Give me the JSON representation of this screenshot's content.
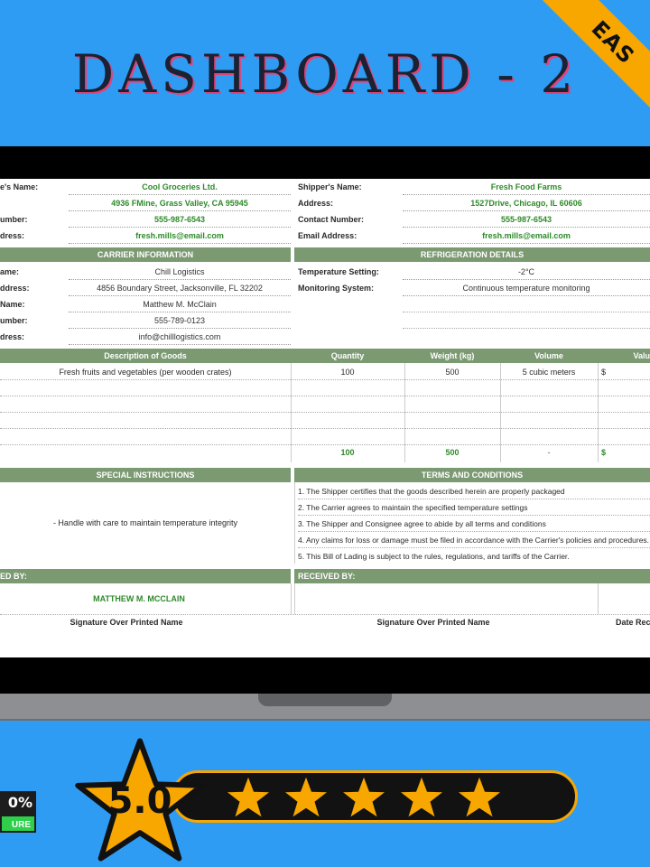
{
  "corner": {
    "label": "EAS"
  },
  "title": "DASHBOARD - 2",
  "shipper_block": {
    "left": [
      {
        "label": "e's Name:",
        "value": "Cool Groceries Ltd."
      },
      {
        "label": "",
        "value": "4936 FMine, Grass Valley, CA 95945"
      },
      {
        "label": "umber:",
        "value": "555-987-6543"
      },
      {
        "label": "dress:",
        "value": "fresh.mills@email.com"
      }
    ],
    "right": [
      {
        "label": "Shipper's Name:",
        "value": "Fresh Food Farms"
      },
      {
        "label": "Address:",
        "value": "1527Drive, Chicago, IL 60606"
      },
      {
        "label": "Contact Number:",
        "value": "555-987-6543"
      },
      {
        "label": "Email Address:",
        "value": "fresh.mills@email.com"
      }
    ]
  },
  "carrier": {
    "header": "CARRIER INFORMATION",
    "rows": [
      {
        "label": "ame:",
        "value": "Chill Logistics"
      },
      {
        "label": "ddress:",
        "value": "4856 Boundary Street, Jacksonville, FL 32202"
      },
      {
        "label": "Name:",
        "value": "Matthew M. McClain"
      },
      {
        "label": "umber:",
        "value": "555-789-0123"
      },
      {
        "label": "dress:",
        "value": "info@chilllogistics.com"
      }
    ]
  },
  "refrigeration": {
    "header": "REFRIGERATION DETAILS",
    "rows": [
      {
        "label": "Temperature Setting:",
        "value": "-2°C"
      },
      {
        "label": "Monitoring System:",
        "value": "Continuous temperature monitoring"
      }
    ]
  },
  "goods": {
    "headers": [
      "Description of Goods",
      "Quantity",
      "Weight (kg)",
      "Volume",
      "Valu"
    ],
    "rows": [
      [
        "Fresh fruits and vegetables (per wooden crates)",
        "100",
        "500",
        "5 cubic meters",
        "$"
      ]
    ],
    "totals": [
      "100",
      "500",
      "-",
      "$"
    ]
  },
  "special": {
    "header": "SPECIAL INSTRUCTIONS",
    "text": "- Handle with care to maintain temperature integrity"
  },
  "terms": {
    "header": "TERMS AND CONDITIONS",
    "items": [
      "1. The Shipper certifies that the goods described herein are properly packaged",
      "2. The Carrier agrees to maintain the specified temperature settings",
      "3. The Shipper and Consignee agree to abide by all terms and conditions",
      "4. Any claims for loss or damage must be filed in accordance with the Carrier's policies and procedures.",
      "5. This Bill of Lading is subject to the rules, regulations, and tariffs of the Carrier."
    ]
  },
  "signatures": {
    "left_header": "ED BY:",
    "right_header": "RECEIVED BY:",
    "left_name": "MATTHEW M. MCCLAIN",
    "left_caption": "Signature Over Printed Name",
    "right_caption": "Signature Over Printed Name",
    "date_caption": "Date Rec"
  },
  "rating": {
    "score": "5.0",
    "stars": 5,
    "max_stars": 5
  },
  "badge": {
    "top": "0%",
    "bottom": "URE"
  },
  "colors": {
    "background": "#2f9cf4",
    "accent": "#f7a700",
    "header_green": "#7b9a72",
    "value_green": "#2e8a2a"
  }
}
